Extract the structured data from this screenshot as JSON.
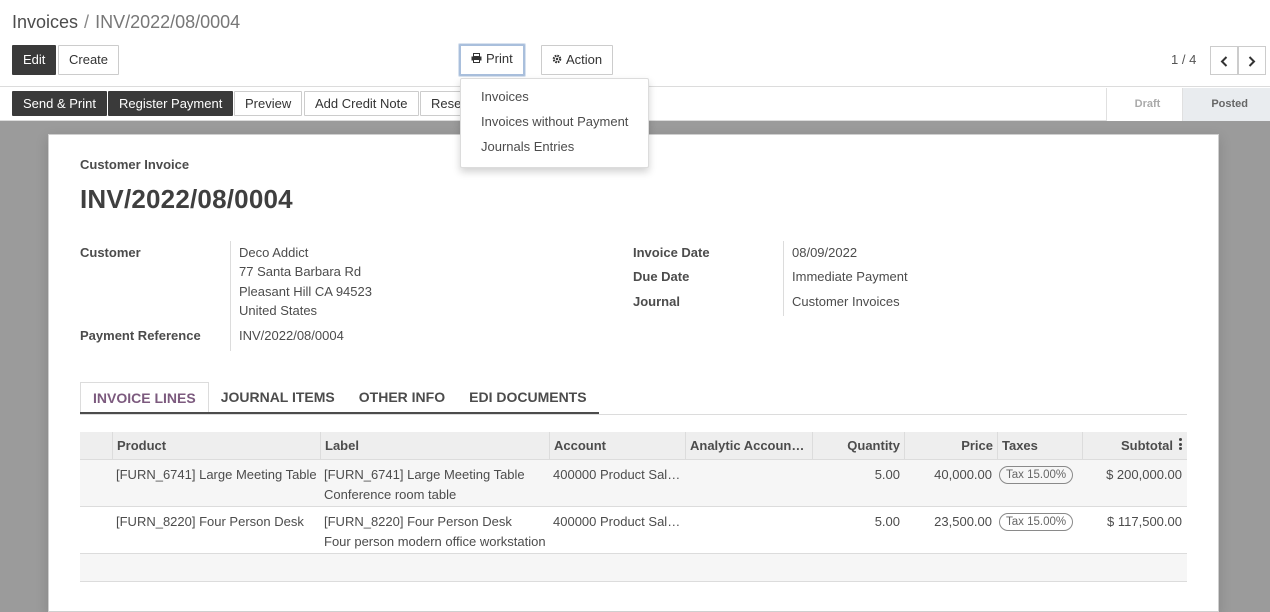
{
  "breadcrumb": {
    "parent": "Invoices",
    "separator": "/",
    "current": "INV/2022/08/0004"
  },
  "toolbar": {
    "edit_label": "Edit",
    "create_label": "Create",
    "print_label": "Print",
    "action_label": "Action",
    "print_icon": "printer-icon",
    "action_icon": "gear-icon"
  },
  "pager": {
    "value": "1 / 4",
    "prev_icon": "chevron-left-icon",
    "next_icon": "chevron-right-icon"
  },
  "print_menu": {
    "items": [
      "Invoices",
      "Invoices without Payment",
      "Journals Entries"
    ]
  },
  "statusbar": {
    "send_print": "Send & Print",
    "register_payment": "Register Payment",
    "preview": "Preview",
    "add_credit_note": "Add Credit Note",
    "reset_partial": "Rese",
    "stages": [
      "Draft",
      "Posted"
    ],
    "current_stage": "Posted"
  },
  "invoice": {
    "type_label": "Customer Invoice",
    "name": "INV/2022/08/0004",
    "customer_label": "Customer",
    "customer_name": "Deco Addict",
    "address_line1": "77 Santa Barbara Rd",
    "address_line2": "Pleasant Hill CA 94523",
    "address_line3": "United States",
    "payment_reference_label": "Payment Reference",
    "payment_reference": "INV/2022/08/0004",
    "invoice_date_label": "Invoice Date",
    "invoice_date": "08/09/2022",
    "due_date_label": "Due Date",
    "due_date": "Immediate Payment",
    "journal_label": "Journal",
    "journal": "Customer Invoices"
  },
  "tabs": [
    {
      "label": "INVOICE LINES",
      "active": true
    },
    {
      "label": "JOURNAL ITEMS",
      "active": false
    },
    {
      "label": "OTHER INFO",
      "active": false
    },
    {
      "label": "EDI DOCUMENTS",
      "active": false
    }
  ],
  "lines_table": {
    "columns": [
      "Product",
      "Label",
      "Account",
      "Analytic Account…",
      "Quantity",
      "Price",
      "Taxes",
      "Subtotal"
    ],
    "rows": [
      {
        "product": "[FURN_6741] Large Meeting Table",
        "label_line1": "[FURN_6741] Large Meeting Table",
        "label_line2": "Conference room table",
        "account": "400000 Product Sal…",
        "analytic": "",
        "quantity": "5.00",
        "price": "40,000.00",
        "tax": "Tax 15.00%",
        "subtotal": "$ 200,000.00"
      },
      {
        "product": "[FURN_8220] Four Person Desk",
        "label_line1": "[FURN_8220] Four Person Desk",
        "label_line2": "Four person modern office workstation",
        "account": "400000 Product Sal…",
        "analytic": "",
        "quantity": "5.00",
        "price": "23,500.00",
        "tax": "Tax 15.00%",
        "subtotal": "$ 117,500.00"
      }
    ]
  },
  "colors": {
    "dark_button": "#3a3a3a",
    "active_tab": "#7c5a7e",
    "backdrop": "#9b9b9b"
  }
}
